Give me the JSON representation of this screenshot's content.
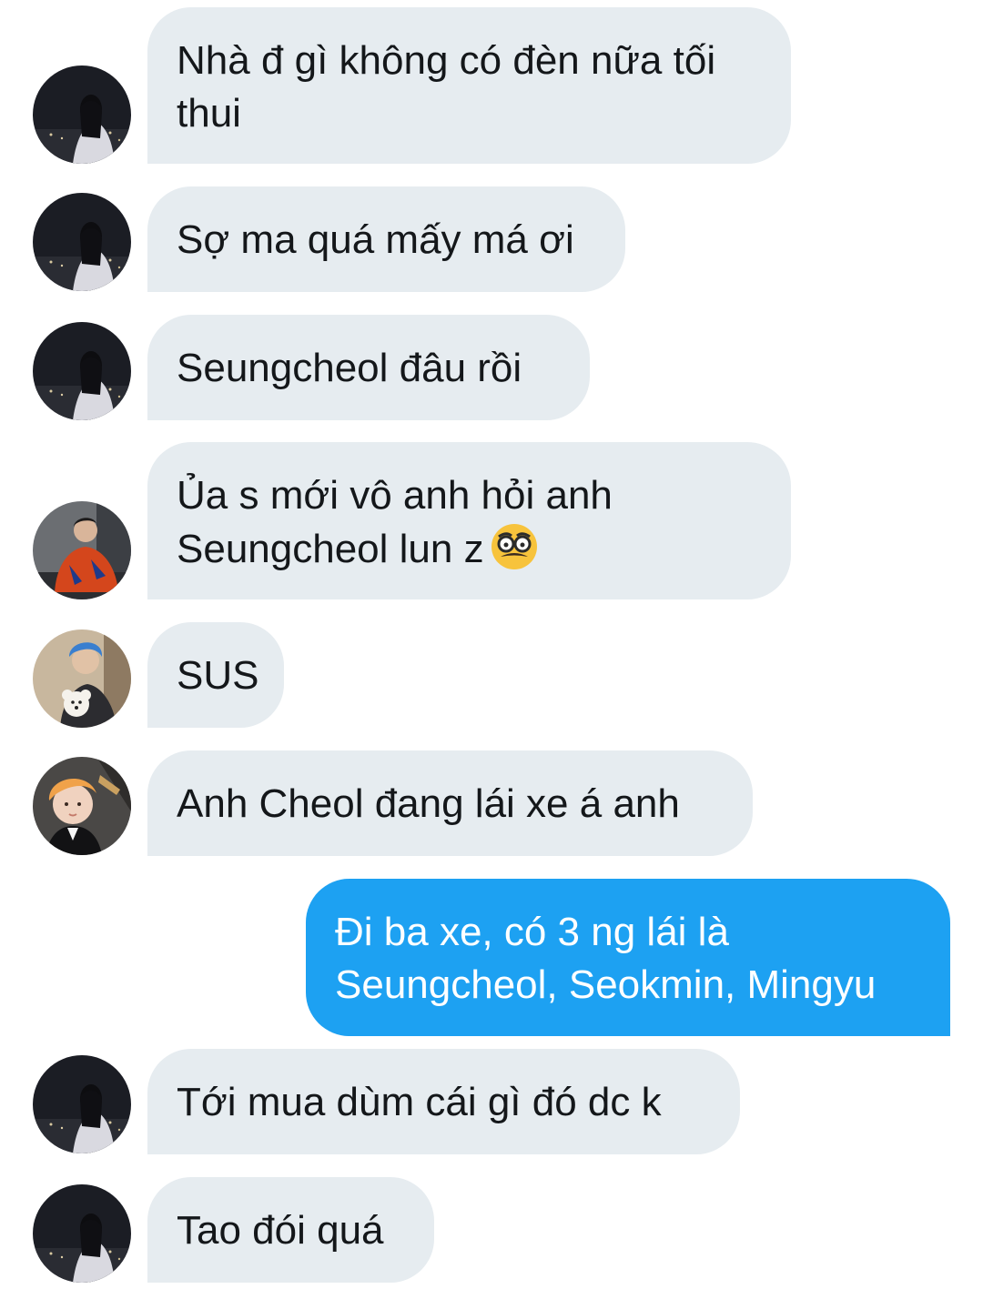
{
  "messages": [
    {
      "direction": "in",
      "avatar": "avatar-night-city-girl",
      "lines": [
        "Nhà đ gì không có đèn nữa tối",
        "thui"
      ]
    },
    {
      "direction": "in",
      "avatar": "avatar-night-city-girl",
      "lines": [
        "Sợ ma quá mấy má ơi"
      ]
    },
    {
      "direction": "in",
      "avatar": "avatar-night-city-girl",
      "lines": [
        "Seungcheol đâu rồi"
      ]
    },
    {
      "direction": "in",
      "avatar": "avatar-man-orange-shirt",
      "lines": [
        "Ủa s mới vô anh hỏi anh",
        "Seungcheol lun z"
      ],
      "trailing_icon": "disguised-face-emoji-icon"
    },
    {
      "direction": "in",
      "avatar": "avatar-blue-hair-with-dog",
      "lines": [
        "SUS"
      ]
    },
    {
      "direction": "in",
      "avatar": "avatar-blonde-selfie",
      "lines": [
        "Anh Cheol đang lái xe á anh"
      ]
    },
    {
      "direction": "out",
      "lines": [
        "Đi ba xe, có 3 ng lái là",
        "Seungcheol, Seokmin, Mingyu"
      ]
    },
    {
      "direction": "in",
      "avatar": "avatar-night-city-girl",
      "lines": [
        "Tới mua dùm cái gì đó dc k"
      ]
    },
    {
      "direction": "in",
      "avatar": "avatar-night-city-girl",
      "lines": [
        "Tao đói quá"
      ]
    }
  ],
  "colors": {
    "incoming_bubble": "#e6ecf0",
    "outgoing_bubble": "#1da1f2",
    "incoming_text": "#14171a",
    "outgoing_text": "#ffffff"
  }
}
